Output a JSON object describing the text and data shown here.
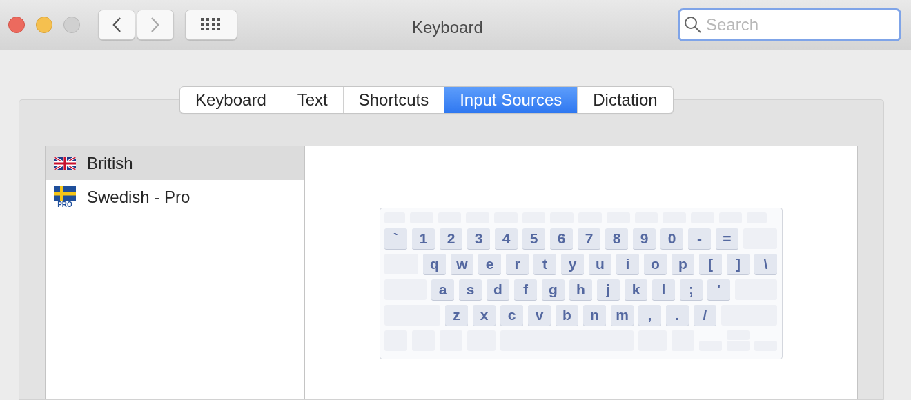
{
  "window": {
    "title": "Keyboard"
  },
  "search": {
    "placeholder": "Search"
  },
  "tabs": [
    {
      "label": "Keyboard",
      "selected": false
    },
    {
      "label": "Text",
      "selected": false
    },
    {
      "label": "Shortcuts",
      "selected": false
    },
    {
      "label": "Input Sources",
      "selected": true
    },
    {
      "label": "Dictation",
      "selected": false
    }
  ],
  "input_sources": [
    {
      "name": "British",
      "kind": "uk",
      "selected": true
    },
    {
      "name": "Swedish - Pro",
      "kind": "se",
      "badge": "PRO",
      "selected": false
    }
  ],
  "keyboard_rows": [
    [
      "`",
      "1",
      "2",
      "3",
      "4",
      "5",
      "6",
      "7",
      "8",
      "9",
      "0",
      "-",
      "="
    ],
    [
      "q",
      "w",
      "e",
      "r",
      "t",
      "y",
      "u",
      "i",
      "o",
      "p",
      "[",
      "]",
      "\\"
    ],
    [
      "a",
      "s",
      "d",
      "f",
      "g",
      "h",
      "j",
      "k",
      "l",
      ";",
      "'"
    ],
    [
      "z",
      "x",
      "c",
      "v",
      "b",
      "n",
      "m",
      ",",
      ".",
      "/"
    ]
  ]
}
